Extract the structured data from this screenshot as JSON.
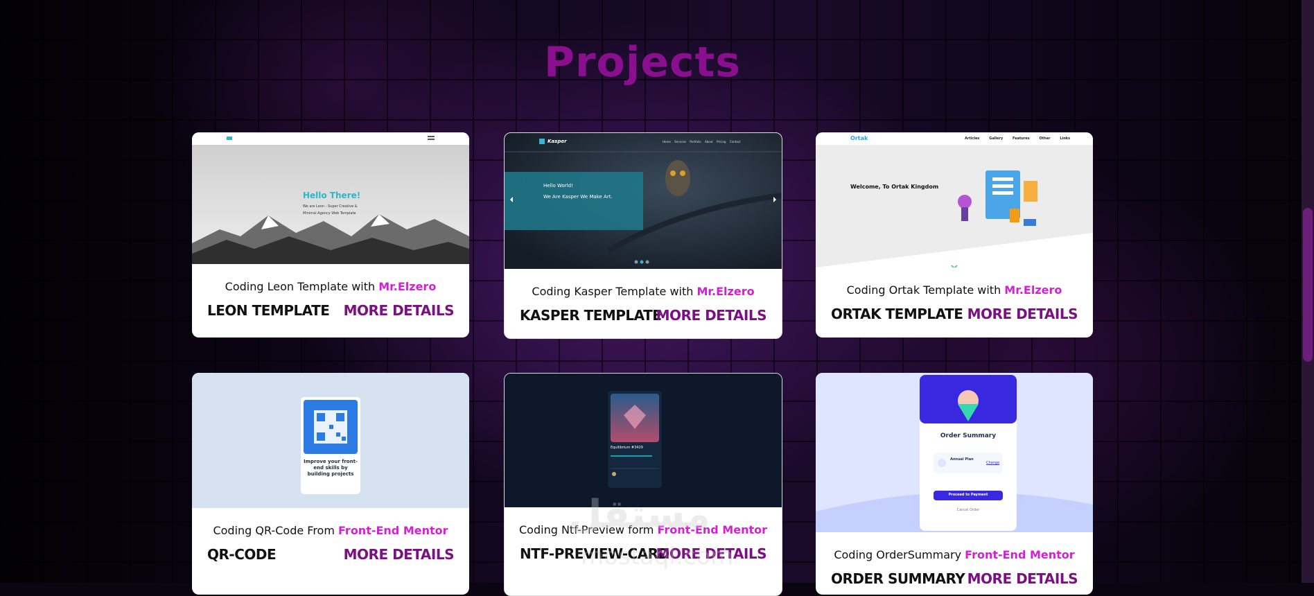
{
  "section_title": "Projects",
  "cards": [
    {
      "desc_prefix": "Coding Leon Template with ",
      "author": "Mr.Elzero",
      "name": "LEON TEMPLATE",
      "more": "MORE DETAILS",
      "thumb": {
        "heading": "Hello There!",
        "line1": "We are Leon - Super Creative &",
        "line2": "Minimal Agency Web Template"
      }
    },
    {
      "desc_prefix": "Coding Kasper Template with ",
      "author": "Mr.Elzero",
      "name": "KASPER TEMPLATE",
      "more": "MORE DETAILS",
      "thumb": {
        "brand": "Kasper",
        "line1": "Hello World!",
        "line2": "We Are Kasper We Make Art.",
        "nav": [
          "Home",
          "Services",
          "Portfolio",
          "About",
          "Pricing",
          "Contact"
        ]
      }
    },
    {
      "desc_prefix": "Coding Ortak Template with ",
      "author": "Mr.Elzero",
      "name": "ORTAK TEMPLATE",
      "more": "MORE DETAILS",
      "thumb": {
        "brand": "Ortak",
        "heading": "Welcome, To Ortak Kingdom",
        "nav": [
          "Articles",
          "Gallery",
          "Features",
          "Other Links"
        ]
      }
    },
    {
      "desc_prefix": "Coding QR-Code From ",
      "author": "Front-End Mentor",
      "name": "QR-CODE",
      "more": "MORE DETAILS",
      "thumb": {
        "text": "Improve your front-end skills by building projects"
      }
    },
    {
      "desc_prefix": "Coding Ntf-Preview form ",
      "author": "Front-End Mentor",
      "name": "NTF-PREVIEW-CARD",
      "more": "MORE DETAILS",
      "thumb": {
        "text": "Equilibrium #3429"
      }
    },
    {
      "desc_prefix": "Coding OrderSummary ",
      "author": "Front-End Mentor",
      "name": "ORDER SUMMARY",
      "more": "MORE DETAILS",
      "thumb": {
        "heading": "Order Summary",
        "plan": "Annual Plan",
        "change": "Change",
        "button": "Proceed to Payment",
        "cancel": "Cancel Order"
      }
    }
  ],
  "watermark": {
    "arabic": "مستقل",
    "latin": "mostaql.com"
  },
  "colors": {
    "title": "#8a0f8e",
    "author": "#d41fd6",
    "more": "#7c0f84"
  }
}
